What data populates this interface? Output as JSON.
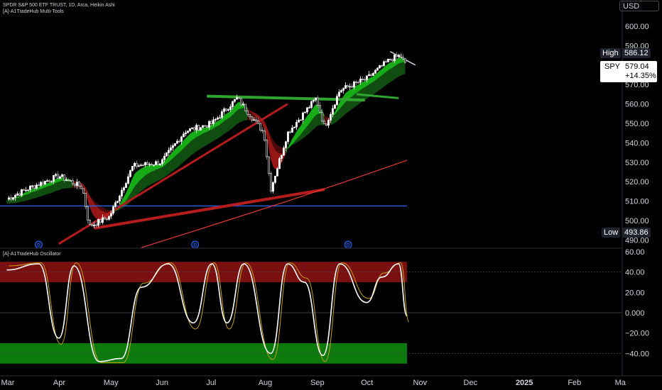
{
  "header": {
    "title": "SPDR S&P 500 ETF TRUST, 1D, Arca, Heikin Ashi",
    "indicator": "[A]-A1TradeHub Multi-Tools"
  },
  "oscillator_label": "[A]-A1TradeHub Oscillator",
  "currency": "USD",
  "price_axis": {
    "ticks": [
      "600.00",
      "590.00",
      "580.00",
      "570.00",
      "560.00",
      "550.00",
      "540.00",
      "530.00",
      "520.00",
      "510.00",
      "500.00",
      "490.00"
    ]
  },
  "osc_axis": {
    "ticks": [
      "60.00",
      "40.00",
      "20.00",
      "0.000",
      "−20.00",
      "−40.00"
    ]
  },
  "time_axis": {
    "labels": [
      "Mar",
      "Apr",
      "May",
      "Jun",
      "Jul",
      "Aug",
      "Sep",
      "Oct",
      "Nov",
      "Dec",
      "2025",
      "Feb",
      "Ma"
    ]
  },
  "tags": {
    "high_label": "High",
    "high_value": "586.12",
    "symbol": "SPY",
    "last_price": "579.04",
    "change": "+14.35%",
    "low_label": "Low",
    "low_value": "493.86"
  },
  "colors": {
    "background": "#000000",
    "bull": "#ffffff",
    "ribbon_green": "#1e8c1e",
    "ribbon_red": "#8b1010",
    "support_line": "#2962ff",
    "trend_red": "#b71c1c",
    "osc_main": "#ffffff",
    "osc_signal": "#c8a21a",
    "ob_zone": "#7a1010",
    "os_zone": "#0d7a0d"
  },
  "chart_data": [
    {
      "type": "candlestick",
      "name": "SPY (Heikin Ashi)",
      "x": [
        "2024-03-01",
        "2024-03-15",
        "2024-04-01",
        "2024-04-15",
        "2024-04-19",
        "2024-05-01",
        "2024-05-15",
        "2024-06-01",
        "2024-06-15",
        "2024-07-01",
        "2024-07-16",
        "2024-08-01",
        "2024-08-05",
        "2024-08-15",
        "2024-09-01",
        "2024-09-06",
        "2024-09-15",
        "2024-10-01",
        "2024-10-15",
        "2024-10-21",
        "2024-10-25"
      ],
      "close": [
        511,
        517,
        523,
        517,
        497,
        502,
        528,
        530,
        546,
        550,
        563,
        545,
        516,
        545,
        563,
        548,
        567,
        573,
        583,
        585,
        579
      ],
      "ylim": [
        486,
        606
      ],
      "last": 579.04,
      "high": 586.12,
      "low": 493.86,
      "change_pct": 14.35,
      "support_level": 507.5
    },
    {
      "type": "line",
      "name": "[A]-A1TradeHub Oscillator",
      "x": [
        "2024-03-01",
        "2024-03-20",
        "2024-04-01",
        "2024-04-10",
        "2024-04-25",
        "2024-05-08",
        "2024-05-20",
        "2024-06-05",
        "2024-06-20",
        "2024-07-01",
        "2024-07-10",
        "2024-07-20",
        "2024-08-05",
        "2024-08-15",
        "2024-08-25",
        "2024-09-05",
        "2024-09-15",
        "2024-10-01",
        "2024-10-10",
        "2024-10-20",
        "2024-10-25"
      ],
      "values": [
        42,
        48,
        -25,
        46,
        -48,
        -45,
        25,
        48,
        -10,
        48,
        -10,
        48,
        -40,
        48,
        30,
        -42,
        48,
        10,
        35,
        48,
        -3
      ],
      "ylim": [
        -50,
        62
      ],
      "overbought_zone": [
        30,
        50
      ],
      "oversold_zone": [
        -50,
        -30
      ]
    }
  ]
}
